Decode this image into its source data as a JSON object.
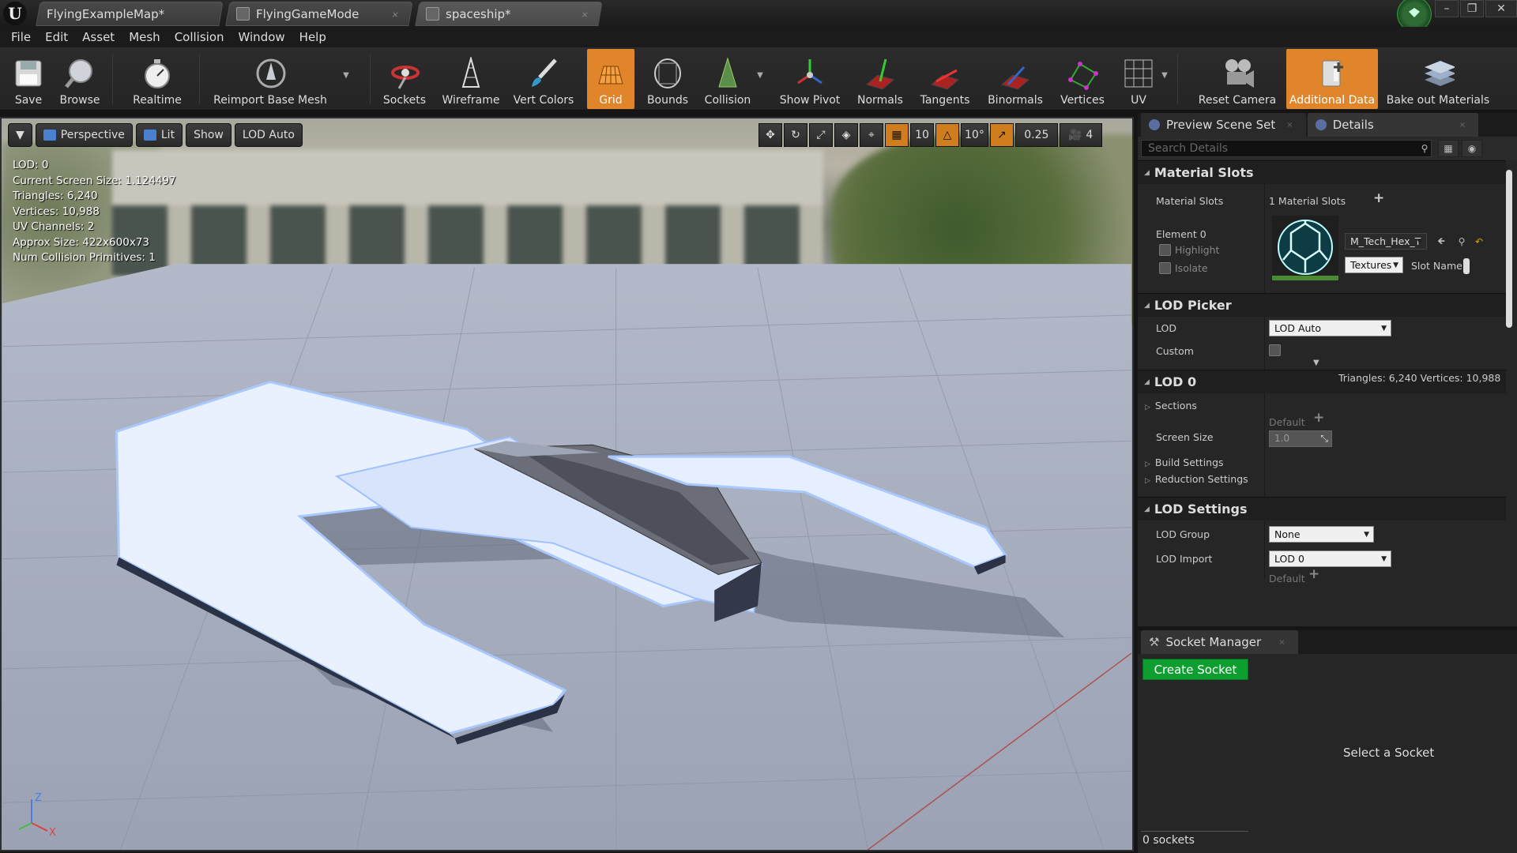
{
  "titlebar": {
    "tabs": [
      {
        "label": "FlyingExampleMap*"
      },
      {
        "label": "FlyingGameMode"
      },
      {
        "label": "spaceship*"
      }
    ],
    "logo_text": "U",
    "close_glyph": "×",
    "controls": {
      "minimize": "–",
      "restore": "❐",
      "close": "✕"
    }
  },
  "menu": [
    "File",
    "Edit",
    "Asset",
    "Mesh",
    "Collision",
    "Window",
    "Help"
  ],
  "toolbar": {
    "save": "Save",
    "browse": "Browse",
    "realtime": "Realtime",
    "reimport": "Reimport Base Mesh",
    "sockets": "Sockets",
    "wireframe": "Wireframe",
    "vert_colors": "Vert Colors",
    "grid": "Grid",
    "bounds": "Bounds",
    "collision": "Collision",
    "show_pivot": "Show Pivot",
    "normals": "Normals",
    "tangents": "Tangents",
    "binormals": "Binormals",
    "vertices": "Vertices",
    "uv": "UV",
    "reset_camera": "Reset Camera",
    "additional_data": "Additional Data",
    "bake_out": "Bake out Materials",
    "accent_color": "#e0852a"
  },
  "viewport": {
    "controls": {
      "perspective": "Perspective",
      "lit": "Lit",
      "show": "Show",
      "lod": "LOD Auto"
    },
    "right_tools": {
      "grid_snap": "10",
      "rot_snap": "10°",
      "scale_snap": "0.25",
      "cam_speed": "4"
    },
    "stats": [
      "LOD:  0",
      "Current Screen Size:  1.124497",
      "Triangles:  6,240",
      "Vertices:  10,988",
      "UV Channels:  2",
      "Approx Size:  422x600x73",
      "Num Collision Primitives:  1"
    ],
    "axis": {
      "z": "Z",
      "x": "X"
    }
  },
  "panel": {
    "tabs": {
      "preview": "Preview Scene Set",
      "details": "Details"
    },
    "search_placeholder": "Search Details",
    "material_slots": {
      "header": "Material Slots",
      "label": "Material Slots",
      "count": "1 Material Slots",
      "element": "Element 0",
      "highlight": "Highlight",
      "isolate": "Isolate",
      "material": "M_Tech_Hex_T",
      "textures": "Textures",
      "slot_name": "Slot Name"
    },
    "lod_picker": {
      "header": "LOD Picker",
      "lod_label": "LOD",
      "lod_value": "LOD Auto",
      "custom_label": "Custom"
    },
    "lod0": {
      "header": "LOD 0",
      "stats": "Triangles: 6,240    Vertices: 10,988",
      "sections": "Sections",
      "screen_size": "Screen Size",
      "default": "Default",
      "screen_value": "1.0",
      "build_settings": "Build Settings",
      "reduction_settings": "Reduction Settings"
    },
    "lod_settings": {
      "header": "LOD Settings",
      "group_label": "LOD Group",
      "group_value": "None",
      "import_label": "LOD Import",
      "import_value": "LOD 0",
      "default": "Default"
    }
  },
  "socket_manager": {
    "tab": "Socket Manager",
    "create": "Create Socket",
    "select_hint": "Select a Socket",
    "count": "0 sockets",
    "create_color": "#0c9e2f"
  }
}
